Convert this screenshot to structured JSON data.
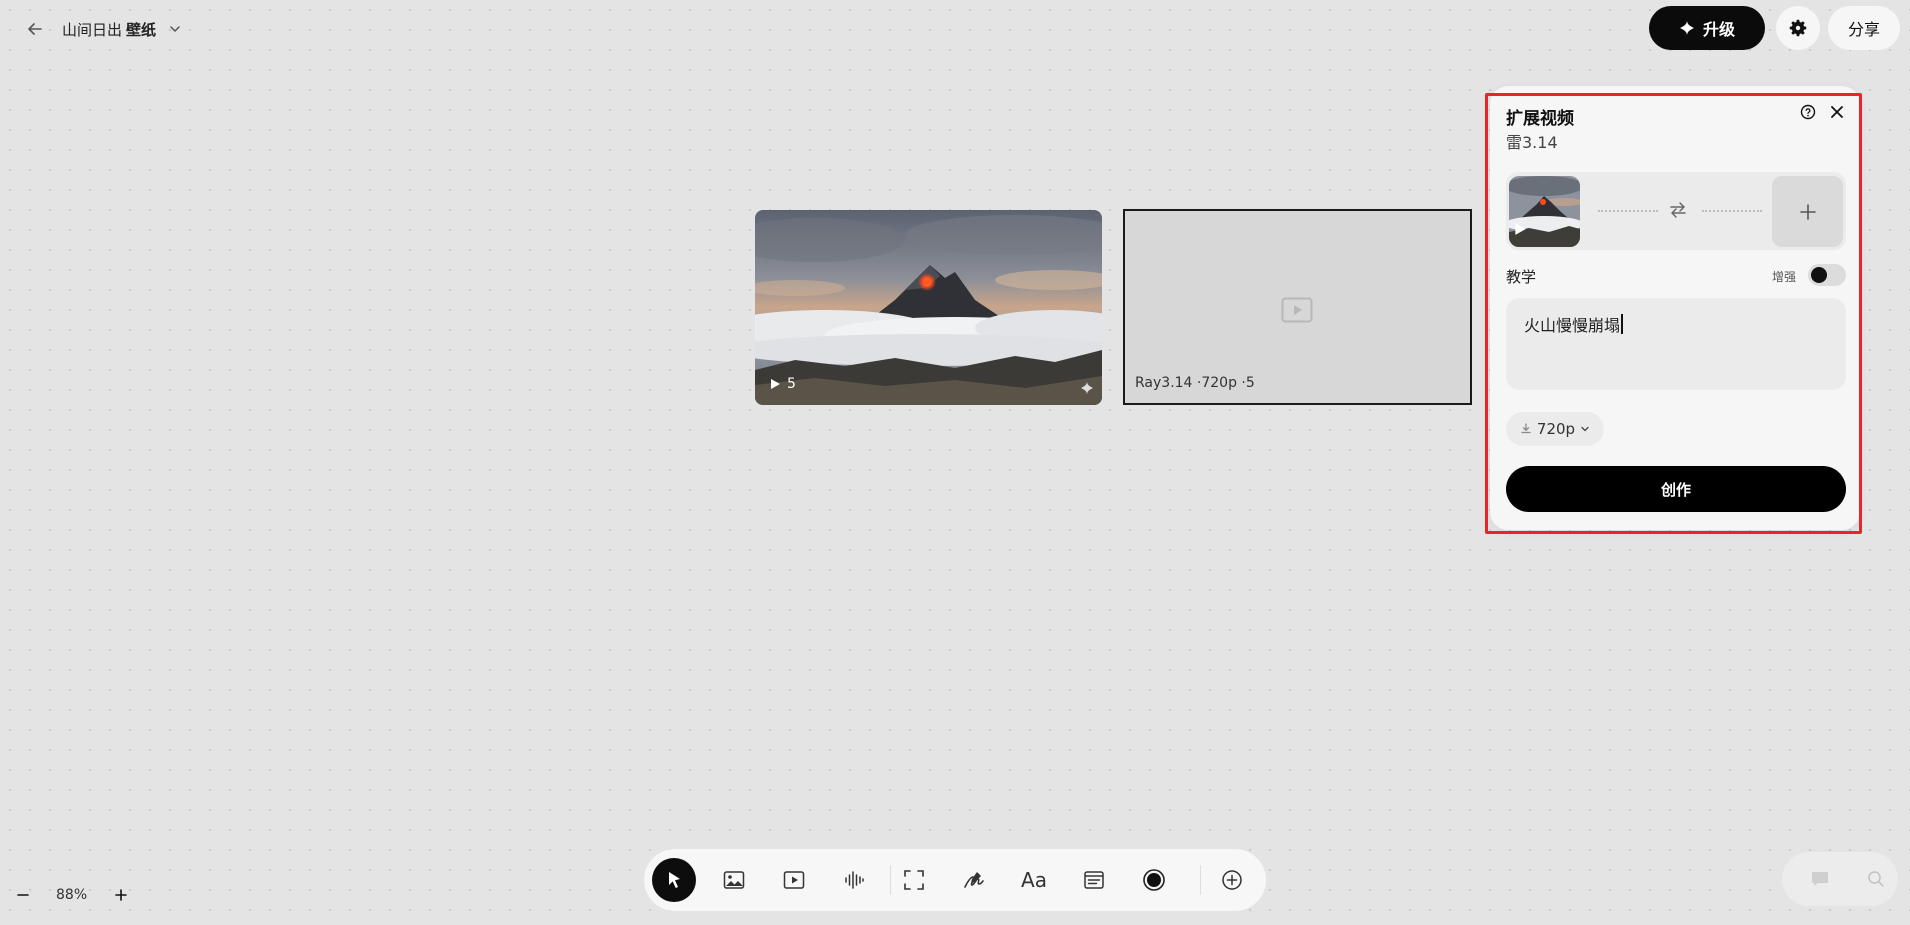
{
  "header": {
    "back_icon": "arrow-left-icon",
    "project_title_prefix": "山间日出",
    "project_title_bold": "壁纸",
    "upgrade_label": "升级",
    "share_label": "分享"
  },
  "canvas": {
    "video_card": {
      "play_count": "5"
    },
    "placeholder_card": {
      "caption": "Ray3.14 ·720p ·5"
    }
  },
  "panel": {
    "title": "扩展视频",
    "subtitle": "雷3.14",
    "teach_label": "教学",
    "enhance_label": "增强",
    "enhance_on": false,
    "prompt_text": "火山慢慢崩塌",
    "resolution": "720p",
    "create_label": "创作",
    "highlight_color": "#e5262b"
  },
  "toolbar": {
    "tools": [
      "select-tool",
      "image-tool",
      "video-tool",
      "audio-tool",
      "frame-tool",
      "draw-tool",
      "text-tool",
      "note-tool",
      "record-tool",
      "add-tool"
    ],
    "text_tool_label": "Aa"
  },
  "zoom": {
    "level": "88%"
  },
  "colors": {
    "canvas_bg": "#e4e4e4",
    "accent_dark": "#0b0b0b",
    "lava": "#ff4a1c"
  }
}
